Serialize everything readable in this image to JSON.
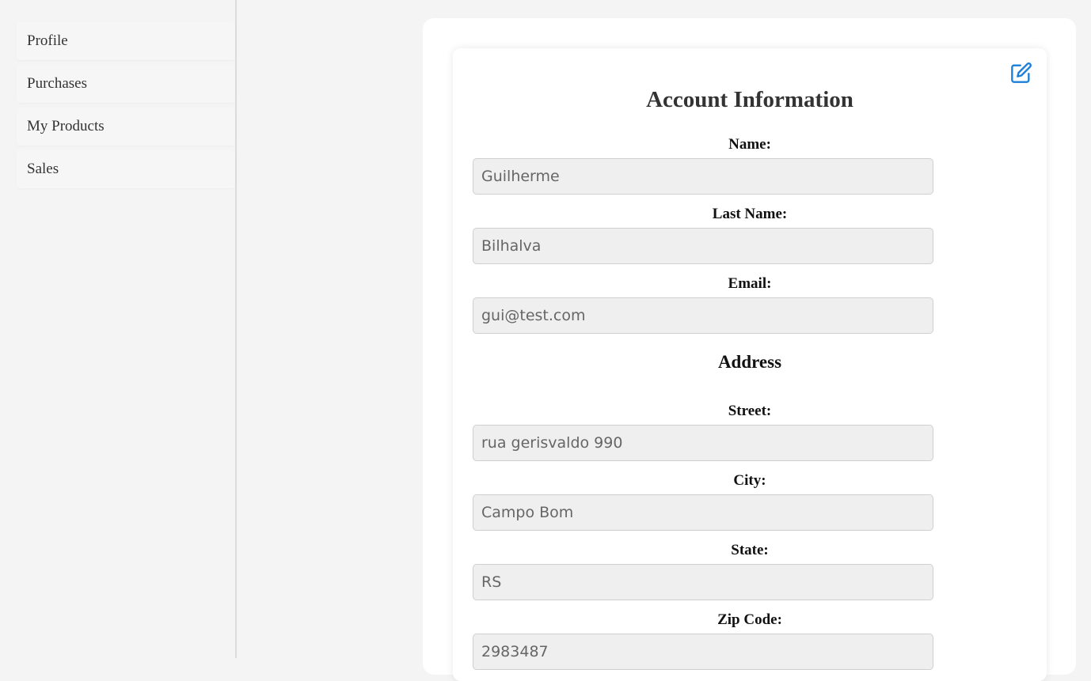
{
  "sidebar": {
    "items": [
      {
        "label": "Profile"
      },
      {
        "label": "Purchases"
      },
      {
        "label": "My Products"
      },
      {
        "label": "Sales"
      }
    ]
  },
  "account": {
    "title": "Account Information",
    "edit_icon": "edit-icon",
    "name_label": "Name:",
    "name_value": "Guilherme",
    "last_name_label": "Last Name:",
    "last_name_value": "Bilhalva",
    "email_label": "Email:",
    "email_value": "gui@test.com",
    "address_heading": "Address",
    "street_label": "Street:",
    "street_value": "rua gerisvaldo 990",
    "city_label": "City:",
    "city_value": "Campo Bom",
    "state_label": "State:",
    "state_value": "RS",
    "zip_label": "Zip Code:",
    "zip_value": "2983487"
  },
  "colors": {
    "accent": "#1a7fd6",
    "background": "#f4f4f4",
    "input_bg": "#efefef"
  }
}
